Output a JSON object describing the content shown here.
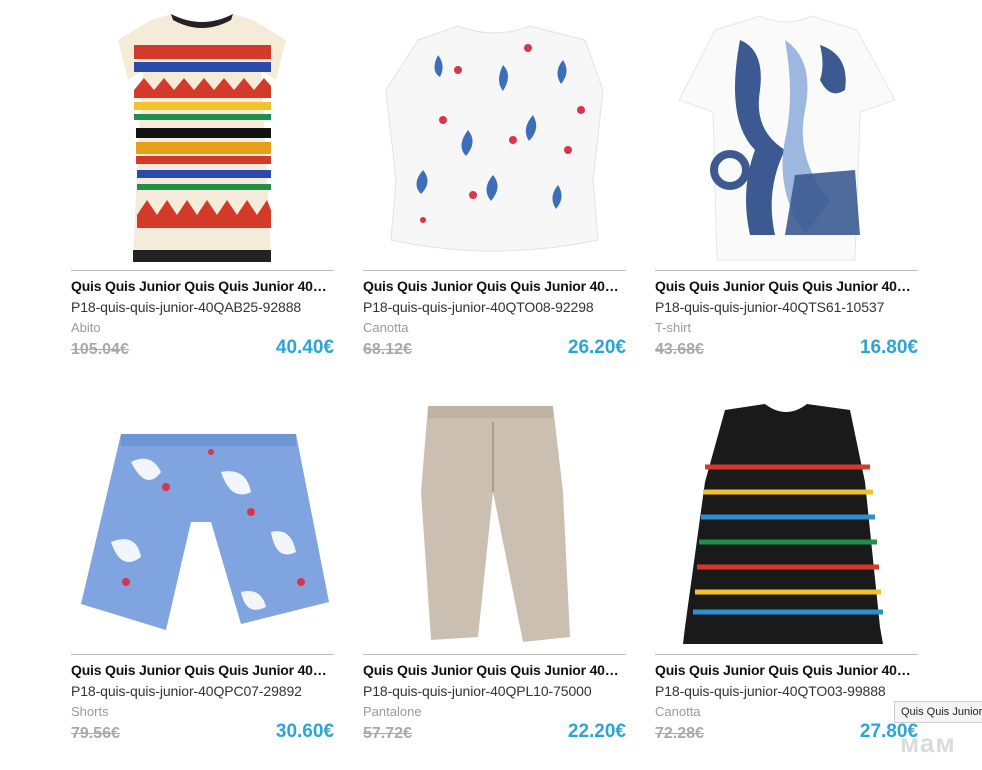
{
  "products": [
    {
      "title": "Quis Quis Junior Quis Quis Junior 40Q...",
      "sku": "P18-quis-quis-junior-40QAB25-92888",
      "category": "Abito",
      "old_price": "105.04€",
      "new_price": "40.40€",
      "image": "patterned-dress"
    },
    {
      "title": "Quis Quis Junior Quis Quis Junior 40QT...",
      "sku": "P18-quis-quis-junior-40QTO08-92298",
      "category": "Canotta",
      "old_price": "68.12€",
      "new_price": "26.20€",
      "image": "floral-top"
    },
    {
      "title": "Quis Quis Junior Quis Quis Junior 40Q...",
      "sku": "P18-quis-quis-junior-40QTS61-10537",
      "category": "T-shirt",
      "old_price": "43.68€",
      "new_price": "16.80€",
      "image": "graphic-tshirt"
    },
    {
      "title": "Quis Quis Junior Quis Quis Junior 40Q...",
      "sku": "P18-quis-quis-junior-40QPC07-29892",
      "category": "Shorts",
      "old_price": "79.56€",
      "new_price": "30.60€",
      "image": "floral-shorts"
    },
    {
      "title": "Quis Quis Junior Quis Quis Junior 40Q...",
      "sku": "P18-quis-quis-junior-40QPL10-75000",
      "category": "Pantalone",
      "old_price": "57.72€",
      "new_price": "22.20€",
      "image": "beige-pants"
    },
    {
      "title": "Quis Quis Junior Quis Quis Junior 40QT...",
      "sku": "P18-quis-quis-junior-40QTO03-99888",
      "category": "Canotta",
      "old_price": "72.28€",
      "new_price": "27.80€",
      "image": "fringe-top"
    }
  ],
  "tooltip": "Quis Quis Junior Quis Quis Junior",
  "watermark": "мам",
  "colors": {
    "price_accent": "#2aa6d6",
    "old_price": "#a9a9a9",
    "divider": "#bdbdbd"
  }
}
